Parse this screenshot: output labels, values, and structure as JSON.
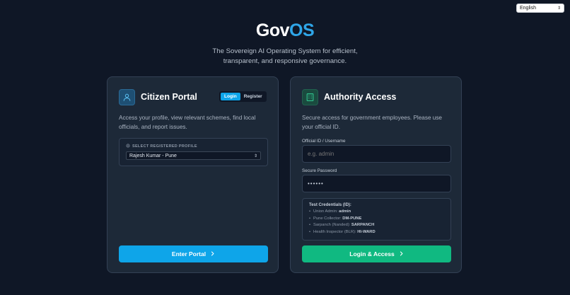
{
  "language": {
    "selected": "English"
  },
  "brand": {
    "part1": "Gov",
    "part2": "OS"
  },
  "tagline": {
    "line1": "The Sovereign AI Operating System for efficient,",
    "line2": "transparent, and responsive governance."
  },
  "citizen": {
    "title": "Citizen Portal",
    "tabs": {
      "login": "Login",
      "register": "Register"
    },
    "description": "Access your profile, view relevant schemes, find local officials, and report issues.",
    "profile_label": "SELECT REGISTERED PROFILE",
    "profile_selected": "Rajesh Kumar - Pune",
    "button_label": "Enter Portal"
  },
  "authority": {
    "title": "Authority Access",
    "description": "Secure access for government employees. Please use your official ID.",
    "id_label": "Official ID / Username",
    "id_placeholder": "e.g. admin",
    "password_label": "Secure Password",
    "password_value": "••••••",
    "creds_title": "Test Credentials (ID):",
    "creds": [
      {
        "role": "Union Admin:",
        "id": "admin"
      },
      {
        "role": "Pune Collector:",
        "id": "DM-PUNE"
      },
      {
        "role": "Sarpanch (Nanded):",
        "id": "SARPANCH"
      },
      {
        "role": "Health Inspector (BLR):",
        "id": "HI-WARD"
      }
    ],
    "button_label": "Login & Access"
  },
  "colors": {
    "background": "#0f1726",
    "card": "#1d2938",
    "citizen_accent": "#0ea5e9",
    "authority_accent": "#10b981",
    "brand_blue": "#2fa6e8"
  },
  "icons": {
    "citizen": "user-icon",
    "authority": "building-icon",
    "language": "chevron-updown-icon",
    "button": "chevron-right-icon"
  }
}
